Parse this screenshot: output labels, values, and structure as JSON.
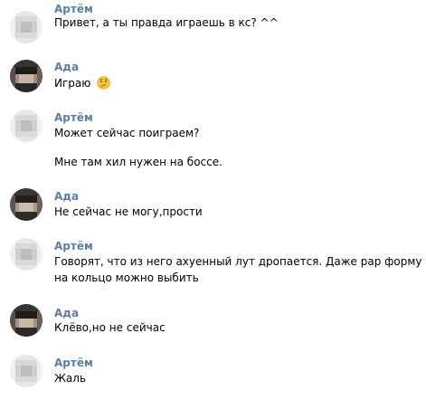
{
  "colors": {
    "author_name": "#5a7ea6",
    "text": "#000000",
    "background": "#ffffff"
  },
  "messages": [
    {
      "author": "Артём",
      "lines": [
        "Привет, а ты правда играешь в кс? ^^"
      ]
    },
    {
      "author": "Ада",
      "lines": [
        "Играю"
      ],
      "emoji": "thinking-face-icon"
    },
    {
      "author": "Артём",
      "lines": [
        "Может сейчас поиграем?",
        "Мне там хил нужен на боссе."
      ]
    },
    {
      "author": "Ада",
      "lines": [
        "Не сейчас не могу,прости"
      ]
    },
    {
      "author": "Артём",
      "lines": [
        "Говорят, что из него ахуенный лут дропается. Даже рар форму",
        "на кольцо можно выбить"
      ]
    },
    {
      "author": "Ада",
      "lines": [
        "Клёво,но не сейчас"
      ]
    },
    {
      "author": "Артём",
      "lines": [
        "Жаль"
      ]
    }
  ]
}
